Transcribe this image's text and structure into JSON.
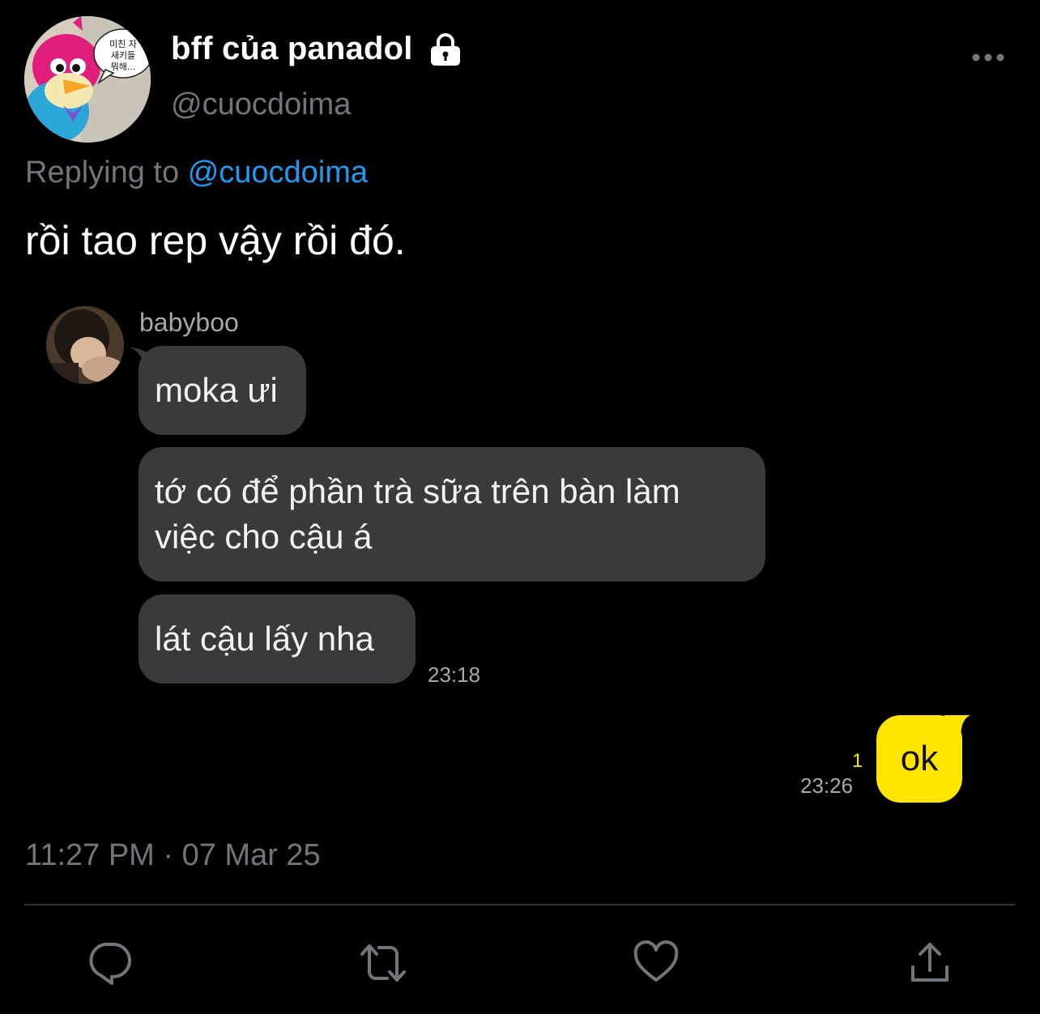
{
  "tweet": {
    "display_name": "bff của panadol",
    "handle": "@cuocdoima",
    "protected_icon": "lock-icon",
    "replying_prefix": "Replying to",
    "replying_to": "@cuocdoima",
    "text": "rồi tao rep vậy rồi đó.",
    "timestamp": "11:27 PM · 07 Mar 25"
  },
  "avatar": {
    "speech_line1": "미친 자",
    "speech_line2": "새키들",
    "speech_line3": "뭐해..."
  },
  "chat": {
    "sender": "babyboo",
    "incoming": [
      {
        "text": "moka ưi"
      },
      {
        "text_line1": "tớ có để phần trà sữa trên bàn làm",
        "text_line2": "việc cho cậu á"
      },
      {
        "text": "lát cậu lấy nha"
      }
    ],
    "incoming_time": "23:18",
    "outgoing": {
      "text": "ok",
      "unread_count": "1",
      "time": "23:26"
    },
    "colors": {
      "incoming_bubble": "#3a3a3c",
      "outgoing_bubble": "#fee500"
    }
  },
  "actions": [
    {
      "name": "reply",
      "icon": "reply-icon"
    },
    {
      "name": "retweet",
      "icon": "retweet-icon"
    },
    {
      "name": "like",
      "icon": "heart-icon"
    },
    {
      "name": "share",
      "icon": "share-icon"
    }
  ],
  "colors": {
    "background": "#000000",
    "mention": "#1d9bf0",
    "muted": "#71767b"
  }
}
